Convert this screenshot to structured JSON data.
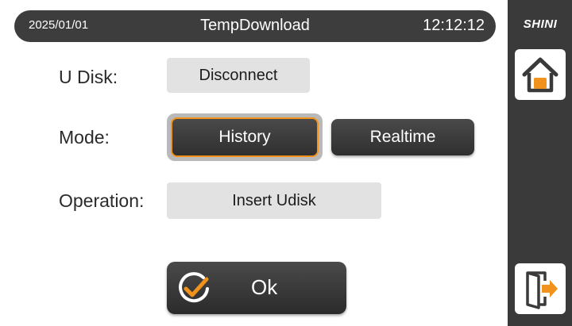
{
  "header": {
    "date": "2025/01/01",
    "title": "TempDownload",
    "time": "12:12:12"
  },
  "sidebar": {
    "logo": "SHINI",
    "home_icon": "home-icon",
    "exit_icon": "exit-door-icon",
    "accent_color": "#f0921c"
  },
  "form": {
    "udisk_label": "U Disk:",
    "udisk_value": "Disconnect",
    "mode_label": "Mode:",
    "mode_options": [
      "History",
      "Realtime"
    ],
    "mode_selected": "History",
    "operation_label": "Operation:",
    "operation_value": "Insert Udisk"
  },
  "ok_button": {
    "label": "Ok",
    "icon": "check-circle-icon"
  }
}
